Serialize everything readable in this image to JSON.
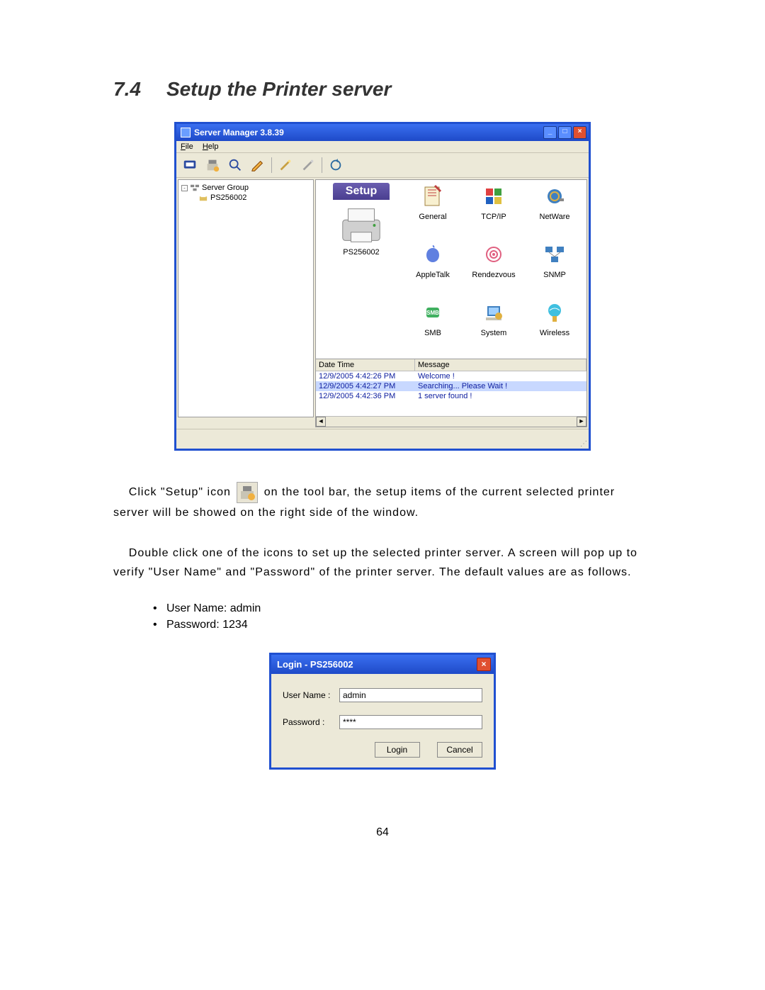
{
  "heading": {
    "number": "7.4",
    "title": "Setup the Printer server"
  },
  "window": {
    "title": "Server Manager 3.8.39",
    "menus": {
      "file": "File",
      "help": "Help"
    },
    "tree": {
      "root": "Server Group",
      "child": "PS256002"
    },
    "setup_banner": "Setup",
    "printer_label": "PS256002",
    "icons": {
      "general": "General",
      "tcpip": "TCP/IP",
      "netware": "NetWare",
      "appletalk": "AppleTalk",
      "rendezvous": "Rendezvous",
      "snmp": "SNMP",
      "smb": "SMB",
      "system": "System",
      "wireless": "Wireless"
    },
    "log": {
      "head1": "Date Time",
      "head2": "Message",
      "rows": [
        {
          "dt": "12/9/2005 4:42:26 PM",
          "msg": "Welcome !"
        },
        {
          "dt": "12/9/2005 4:42:27 PM",
          "msg": "Searching... Please Wait !"
        },
        {
          "dt": "12/9/2005 4:42:36 PM",
          "msg": "1 server found !"
        }
      ]
    }
  },
  "para": {
    "p1a": "Click \"Setup\" icon",
    "p1b": "on the tool bar, the setup items of the current selected printer server will be showed on the right side of the window.",
    "p2": "Double click one of the icons to set up the selected printer server. A screen will pop up to verify \"User Name\" and \"Password\" of the printer server. The default values are as follows."
  },
  "bullets": {
    "b1": "User Name: admin",
    "b2": "Password: 1234"
  },
  "login": {
    "title": "Login - PS256002",
    "user_label": "User Name :",
    "pass_label": "Password :",
    "user_value": "admin",
    "pass_value": "****",
    "login_btn": "Login",
    "cancel_btn": "Cancel"
  },
  "page_number": "64"
}
